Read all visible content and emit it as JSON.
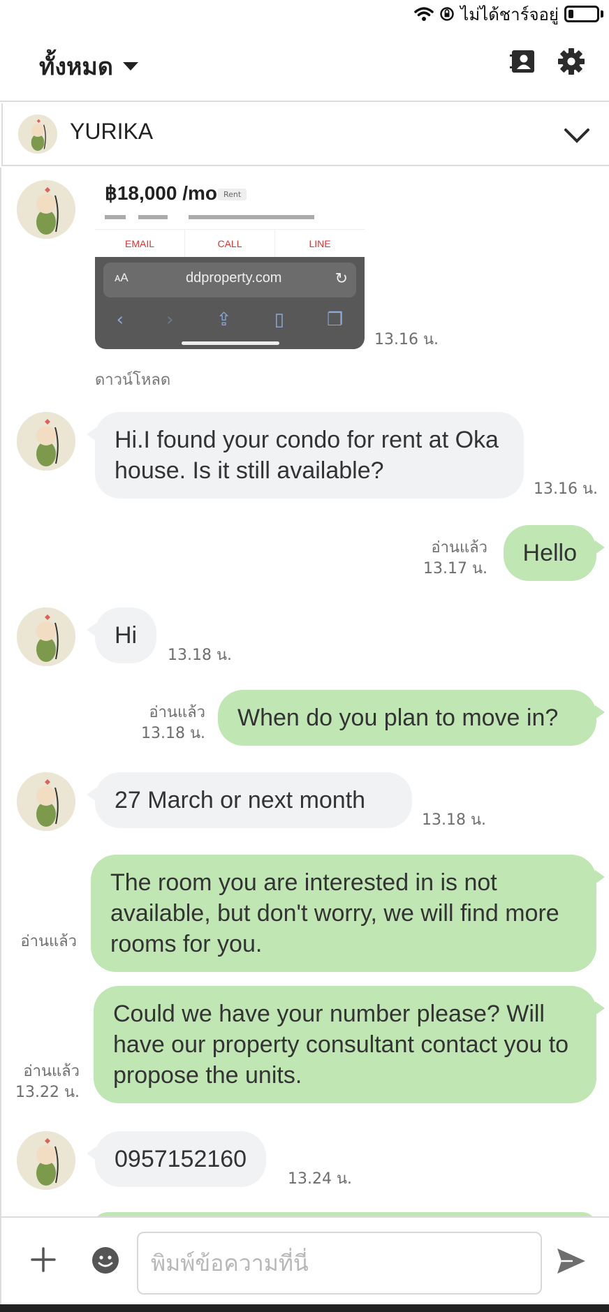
{
  "status_bar": {
    "carrier_text": "ไม่ได้ชาร์จอยู่",
    "wifi_icon": "wifi-icon",
    "lock_icon": "rotation-lock-icon",
    "battery_icon": "battery-icon"
  },
  "header": {
    "filter_label": "ทั้งหมด",
    "contacts_icon": "contacts-icon",
    "settings_icon": "gear-icon"
  },
  "chat": {
    "name": "YURIKA"
  },
  "image_message": {
    "price": "฿18,000 /mo",
    "price_tag": "Rent",
    "cta_email": "EMAIL",
    "cta_call": "CALL",
    "cta_line": "LINE",
    "url_aa": "ᴀA",
    "url": "ddproperty.com",
    "time": "13.16 น.",
    "download_label": "ดาวน์โหลด"
  },
  "messages": [
    {
      "dir": "in",
      "text": "Hi.I found your condo for rent at Oka house. Is it still available?",
      "time": "13.16 น."
    },
    {
      "dir": "out",
      "text": "Hello",
      "read": "อ่านแล้ว",
      "time": "13.17 น."
    },
    {
      "dir": "in",
      "text": "Hi",
      "time": "13.18 น."
    },
    {
      "dir": "out",
      "text": "When do you plan to move in?",
      "read": "อ่านแล้ว",
      "time": "13.18 น."
    },
    {
      "dir": "in",
      "text": "27 March or next month",
      "time": "13.18 น."
    },
    {
      "dir": "out",
      "text": "The room you are interested in is not available, but don't worry, we will find more rooms for you.",
      "read": "อ่านแล้ว",
      "time": ""
    },
    {
      "dir": "out",
      "text": "Could we have your number please? Will have our property consultant contact you to propose the units.",
      "read": "อ่านแล้ว",
      "time": "13.22 น."
    },
    {
      "dir": "in",
      "text": "0957152160",
      "time": "13.24 น."
    }
  ],
  "input": {
    "placeholder": "พิมพ์ข้อความที่นี่"
  },
  "colors": {
    "incoming_bubble": "#f1f2f4",
    "outgoing_bubble": "#c0e6b4",
    "divider": "#dcdcdc"
  }
}
